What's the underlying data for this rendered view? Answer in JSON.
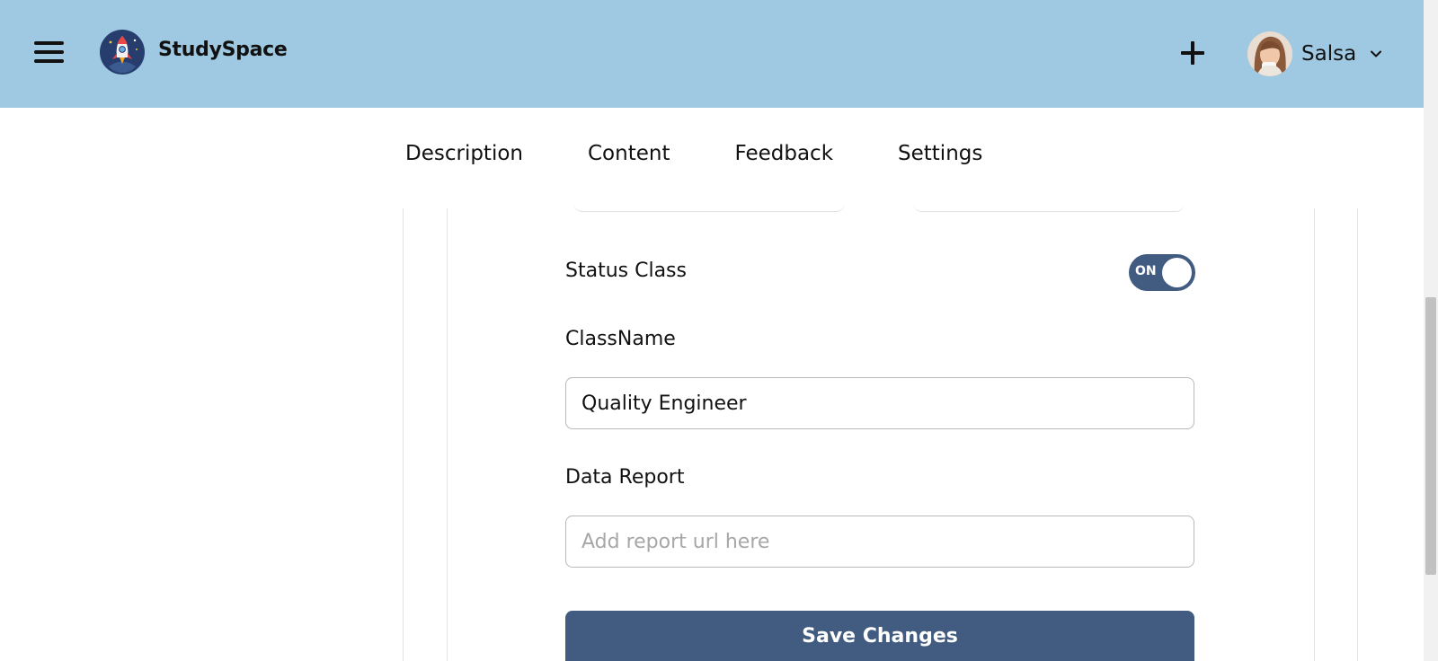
{
  "header": {
    "brand": "StudySpace",
    "user_name": "Salsa",
    "menu_icon": "hamburger-menu-icon",
    "logo_icon": "rocket-logo-icon",
    "add_icon": "plus-icon",
    "dropdown_icon": "chevron-down-icon",
    "background_color": "#9fc9e2"
  },
  "tabs": [
    {
      "label": "Description"
    },
    {
      "label": "Content"
    },
    {
      "label": "Feedback"
    },
    {
      "label": "Settings"
    }
  ],
  "form": {
    "status_label": "Status Class",
    "status_toggle": {
      "text": "ON",
      "state": "on",
      "color": "#425b80"
    },
    "classname_label": "ClassName",
    "classname_value": "Quality Engineer",
    "report_label": "Data Report",
    "report_placeholder": "Add report url here",
    "save_label": "Save Changes"
  }
}
